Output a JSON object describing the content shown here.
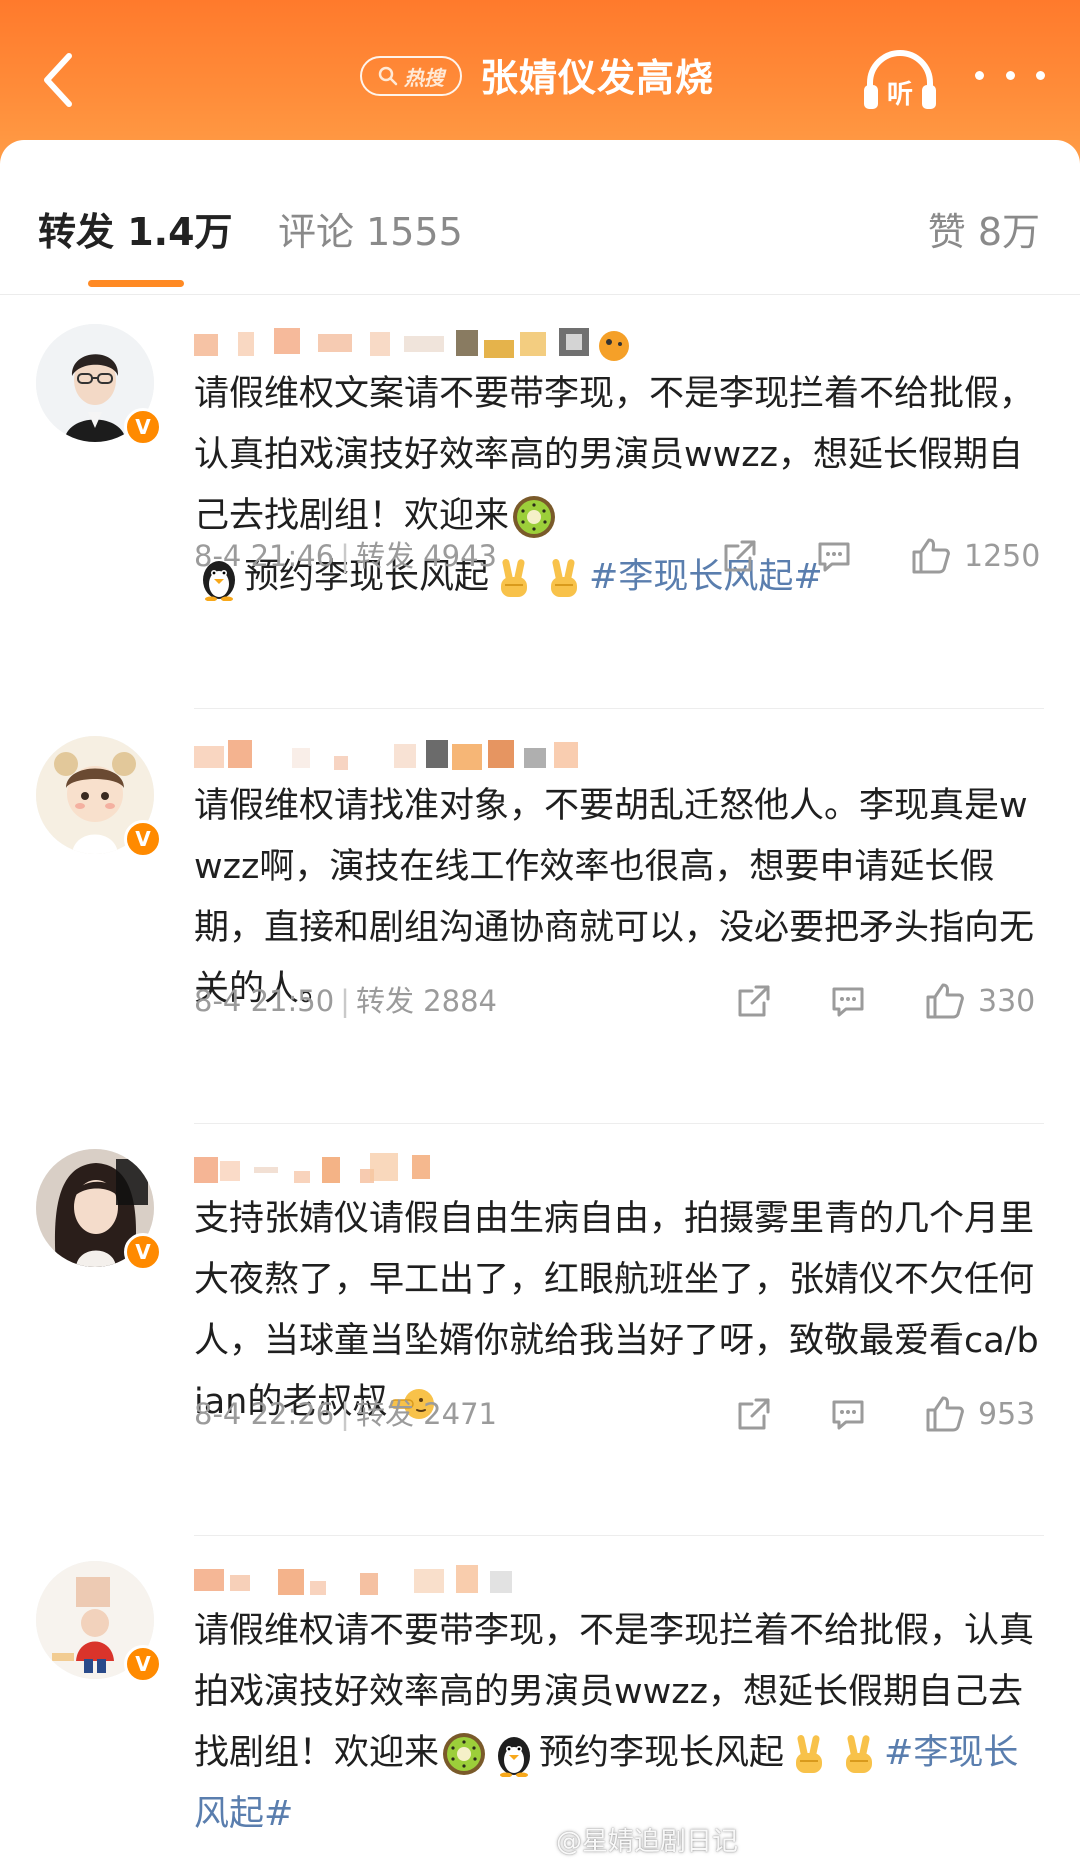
{
  "header": {
    "hot_badge_label": "热搜",
    "title": "张婧仪发高烧",
    "listen_label": "听"
  },
  "tabs": {
    "reposts": "转发 1.4万",
    "comments": "评论 1555",
    "likes": "赞 8万"
  },
  "items": [
    {
      "text_a": "请假维权文案请不要带李现，不是李现拦着不给批假，认真拍戏演技好效率高的男演员wwzz，想延长假期自己去找剧组！欢迎来",
      "text_b": "预约李现长风起",
      "hashtag": "#李现长风起#",
      "time": "8-4 21:46",
      "repost_label": "转发 4943",
      "likes": "1250"
    },
    {
      "text": "请假维权请找准对象，不要胡乱迁怒他人。李现真是wwzz啊，演技在线工作效率也很高，想要申请延长假期，直接和剧组沟通协商就可以，没必要把矛头指向无关的人。",
      "time": "8-4 21:50",
      "repost_label": "转发 2884",
      "likes": "330"
    },
    {
      "text": "支持张婧仪请假自由生病自由，拍摄雾里青的几个月里大夜熬了，早工出了，红眼航班坐了，张婧仪不欠任何人，当球童当坠婿你就给我当好了呀，致敬最爱看ca/bian的老叔叔",
      "time": "8-4 22:26",
      "repost_label": "转发 2471",
      "likes": "953"
    },
    {
      "text_a": "请假维权请不要带李现，不是李现拦着不给批假，认真拍戏演技好效率高的男演员wwzz，想延长假期自己去找剧组！欢迎来",
      "text_b": "预约李现长风起",
      "hashtag": "#李现长风起#"
    }
  ],
  "watermark": "@星婧追剧日记",
  "colors": {
    "header_gradient_top": "#ff7a2c",
    "header_gradient_bottom": "#ffa049",
    "tab_indicator": "#ff8a24",
    "hashtag": "#5a7eae",
    "verified_badge": "#ff8a00",
    "meta_text": "#9b9b9b"
  },
  "icons": {
    "back": "chevron-left-icon",
    "listen": "headphones-icon",
    "more": "more-dots-icon",
    "share": "share-icon",
    "comment": "comment-icon",
    "like": "thumbs-up-icon",
    "verified": "verified-badge-icon"
  }
}
